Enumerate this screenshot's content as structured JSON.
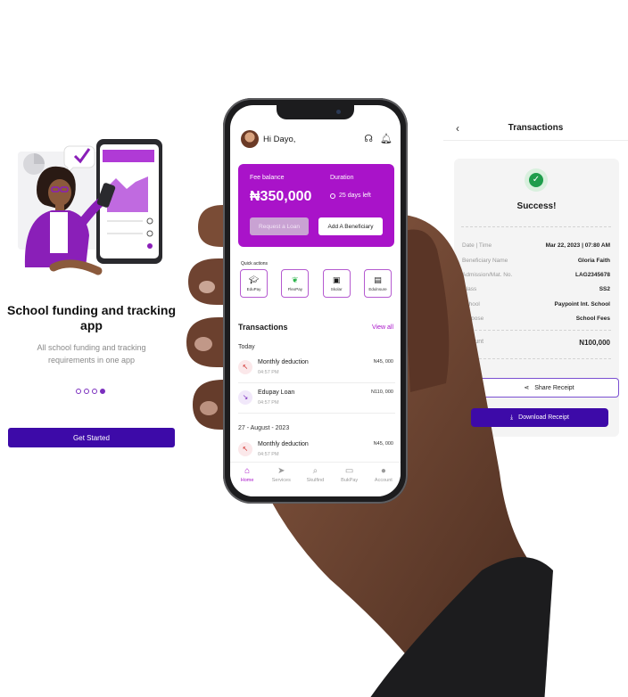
{
  "onboarding": {
    "title": "School funding and tracking app",
    "subtitle": "All school funding and tracking requirements in one app",
    "cta": "Get Started",
    "pages": 4,
    "active_page": 4
  },
  "phone": {
    "greeting": "Hi Dayo,",
    "balance_card": {
      "fee_label": "Fee balance",
      "fee_amount": "₦350,000",
      "duration_label": "Duration",
      "duration_value": "25 days left",
      "loan_button": "Request a Loan",
      "beneficiary_button": "Add A Beneficiary"
    },
    "quick_actions_label": "Quick actions",
    "quick_actions": [
      {
        "label": "EduPay",
        "icon": "graduation-cap-icon"
      },
      {
        "label": "FlexPay",
        "icon": "leaf-icon"
      },
      {
        "label": "Skolar",
        "icon": "book-icon"
      },
      {
        "label": "Edulnsure",
        "icon": "wallet-icon"
      }
    ],
    "transactions_title": "Transactions",
    "view_all": "View all",
    "groups": [
      {
        "label": "Today",
        "items": [
          {
            "name": "Monthly deduction",
            "time": "04:57 PM",
            "amount": "N45, 000",
            "direction": "in"
          },
          {
            "name": "Edupay Loan",
            "time": "04:57 PM",
            "amount": "N110, 000",
            "direction": "out"
          }
        ]
      },
      {
        "label": "27 - August - 2023",
        "items": [
          {
            "name": "Monthly deduction",
            "time": "04:57 PM",
            "amount": "N45, 000",
            "direction": "in"
          }
        ]
      }
    ],
    "tabs": [
      {
        "label": "Home",
        "active": true
      },
      {
        "label": "Services",
        "active": false
      },
      {
        "label": "Skulfind",
        "active": false
      },
      {
        "label": "BukPay",
        "active": false
      },
      {
        "label": "Account",
        "active": false
      }
    ]
  },
  "receipt": {
    "title": "Transactions",
    "status": "Success!",
    "rows": [
      {
        "key": "Date | Time",
        "value": "Mar 22, 2023 | 07:80 AM"
      },
      {
        "key": "Beneficiary Name",
        "value": "Gloria Faith"
      },
      {
        "key": "Admission/Mat. No.",
        "value": "LAG2345678"
      },
      {
        "key": "Class",
        "value": "SS2"
      },
      {
        "key": "School",
        "value": "Paypoint Int. School"
      },
      {
        "key": "Purpose",
        "value": "School Fees"
      }
    ],
    "amount_key": "Amount",
    "amount_value": "N100,000",
    "share_button": "Share Receipt",
    "download_button": "Download Receipt"
  },
  "colors": {
    "brand_purple": "#a913c9",
    "primary_button": "#3d0aa8",
    "success_green": "#1f9d4c"
  }
}
